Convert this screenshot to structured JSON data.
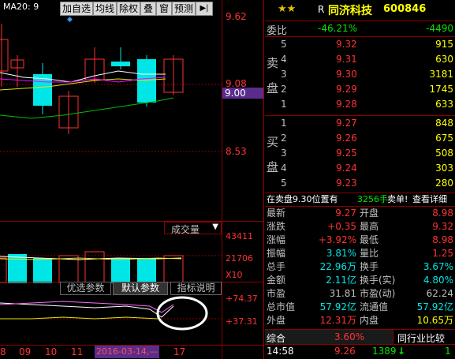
{
  "toolbar": {
    "ma_label": "MA20: 9",
    "buttons": [
      "加自选",
      "均线",
      "除权",
      "叠",
      "窗",
      "预测"
    ],
    "menu_glyph": "▶|",
    "colors": {
      "bg": "#000000",
      "up": "#ff3232",
      "down": "#00e5e5",
      "grid": "#8b0000"
    }
  },
  "price_axis": {
    "top": "9.62",
    "mid": "9.08",
    "cur": "9.00",
    "low": "8.53"
  },
  "volume": {
    "selector_label": "成交量",
    "selector_arrow": "▼",
    "axis_top": "43411",
    "axis_mid": "21706",
    "axis_unit": "X10"
  },
  "indicator": {
    "tabs": [
      "优选参数",
      "默认参数",
      "指标说明"
    ],
    "axis_top": "+74.37",
    "axis_bottom": "+37.31"
  },
  "date_axis": {
    "labels": [
      "8",
      "09",
      "10",
      "11",
      "2016-03-14,—",
      "17"
    ]
  },
  "stock": {
    "stars": "★★",
    "marker": "R",
    "name": "同济科技",
    "code": "600846"
  },
  "weibi": {
    "label": "委比",
    "pct": "-46.21%",
    "diff": "-4490"
  },
  "sell": {
    "label_top": "卖",
    "label_bottom": "盘",
    "rows": [
      {
        "n": "5",
        "price": "9.32",
        "vol": "915"
      },
      {
        "n": "4",
        "price": "9.31",
        "vol": "630"
      },
      {
        "n": "3",
        "price": "9.30",
        "vol": "3181"
      },
      {
        "n": "2",
        "price": "9.29",
        "vol": "1745"
      },
      {
        "n": "1",
        "price": "9.28",
        "vol": "633"
      }
    ]
  },
  "buy": {
    "label_top": "买",
    "label_bottom": "盘",
    "rows": [
      {
        "n": "1",
        "price": "9.27",
        "vol": "848"
      },
      {
        "n": "2",
        "price": "9.26",
        "vol": "675"
      },
      {
        "n": "3",
        "price": "9.25",
        "vol": "508"
      },
      {
        "n": "4",
        "price": "9.24",
        "vol": "303"
      },
      {
        "n": "5",
        "price": "9.23",
        "vol": "280"
      }
    ]
  },
  "notice": {
    "text": "在卖盘9.30位置有",
    "vol": "3256手",
    "tag": "卖单!",
    "link": "查看详细"
  },
  "stats": [
    {
      "l1": "最新",
      "v1": "9.27",
      "c1": "red",
      "l2": "开盘",
      "v2": "8.98",
      "c2": "red"
    },
    {
      "l1": "涨跌",
      "v1": "+0.35",
      "c1": "red",
      "l2": "最高",
      "v2": "9.32",
      "c2": "red"
    },
    {
      "l1": "涨幅",
      "v1": "+3.92%",
      "c1": "red",
      "l2": "最低",
      "v2": "8.98",
      "c2": "red"
    },
    {
      "l1": "振幅",
      "v1": "3.81%",
      "c1": "cyan",
      "l2": "量比",
      "v2": "1.25",
      "c2": "red"
    },
    {
      "l1": "总手",
      "v1": "22.96万",
      "c1": "cyan",
      "l2": "换手",
      "v2": "3.67%",
      "c2": "cyan"
    },
    {
      "l1": "金额",
      "v1": "2.11亿",
      "c1": "cyan",
      "l2": "换手(实)",
      "v2": "4.80%",
      "c2": "cyan"
    },
    {
      "l1": "市盈",
      "v1": "31.81",
      "c1": "gray",
      "l2": "市盈(动)",
      "v2": "62.24",
      "c2": "gray"
    },
    {
      "l1": "总市值",
      "v1": "57.92亿",
      "c1": "cyan",
      "l2": "流通值",
      "v2": "57.92亿",
      "c2": "cyan"
    },
    {
      "l1": "外盘",
      "v1": "12.31万",
      "c1": "red",
      "l2": "内盘",
      "v2": "10.65万",
      "c2": "yellow"
    }
  ],
  "bottom_tabs": {
    "t1": "综合",
    "pct": "3.60%",
    "t2": "同行业比较"
  },
  "tick": {
    "time": "14:58",
    "price": "9.26",
    "vol": "1389",
    "arrow": "↓",
    "flag": "1"
  }
}
